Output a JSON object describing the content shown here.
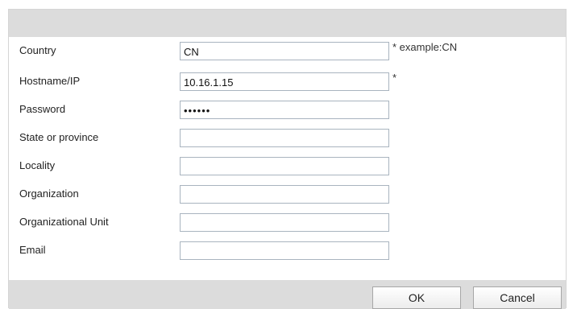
{
  "form": {
    "fields": [
      {
        "label": "Country",
        "value": "CN",
        "hint": "* example:CN"
      },
      {
        "label": "Hostname/IP",
        "value": "10.16.1.15",
        "hint": "*"
      },
      {
        "label": "Password",
        "value": "••••••",
        "hint": ""
      },
      {
        "label": "State or province",
        "value": "",
        "hint": ""
      },
      {
        "label": "Locality",
        "value": "",
        "hint": ""
      },
      {
        "label": "Organization",
        "value": "",
        "hint": ""
      },
      {
        "label": "Organizational Unit",
        "value": "",
        "hint": ""
      },
      {
        "label": "Email",
        "value": "",
        "hint": ""
      }
    ]
  },
  "buttons": {
    "ok_label": "OK",
    "cancel_label": "Cancel"
  },
  "colors": {
    "title_bar": "#dcdcdc",
    "input_border": "#a9b4bf"
  }
}
